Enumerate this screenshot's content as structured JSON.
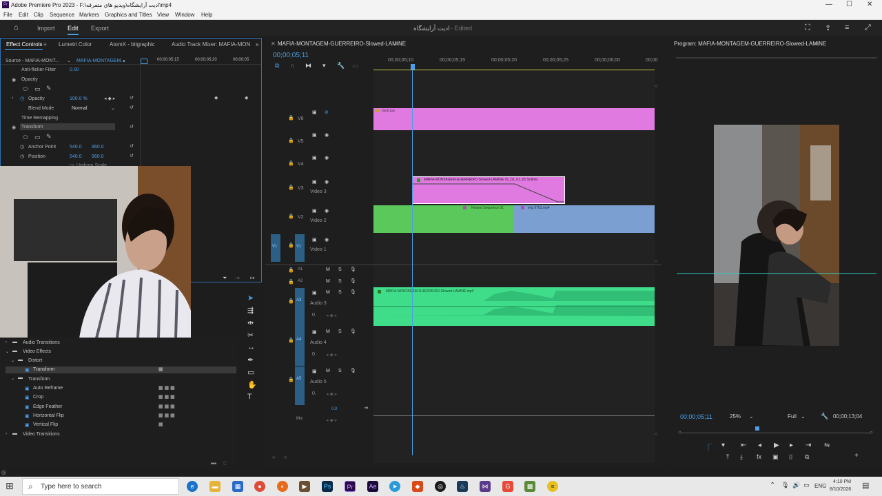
{
  "window": {
    "title": "Adobe Premiere Pro 2023 - F:\\ادیت آرایشگاه\\ویدیو های متفرقه\\mp4",
    "menu": [
      "File",
      "Edit",
      "Clip",
      "Sequence",
      "Markers",
      "Graphics and Titles",
      "View",
      "Window",
      "Help"
    ]
  },
  "header": {
    "nav": [
      "Import",
      "Edit",
      "Export"
    ],
    "active": "Edit",
    "project_title": "ادیت آرایشگاه",
    "edited": "- Edited"
  },
  "effect_controls": {
    "tabs": [
      "Effect Controls",
      "Lumetri Color",
      "AtomX - bitgraphic",
      "Audio Track Mixer: MAFIA-MON"
    ],
    "source": "Source - MAFIA-MONT...",
    "seq": "MAFIA-MONTAGEM...",
    "ruler": [
      "00;00;05;15",
      "00;00;05;20",
      "00;00;05"
    ],
    "rows": {
      "antiflicker": "Anti-flicker Filter",
      "antiflicker_val": "0.00",
      "opacity": "Opacity",
      "opacity_prop": "Opacity",
      "opacity_val": "100.0 %",
      "blend": "Blend Mode",
      "blend_val": "Normal",
      "time_remap": "Time Remapping",
      "transform": "Transform",
      "anchor": "Anchor Point",
      "anchor_x": "540.0",
      "anchor_y": "960.0",
      "position": "Position",
      "pos_x": "540.0",
      "pos_y": "960.0",
      "uniform": "Uniform Scale"
    }
  },
  "effects": {
    "audio_transitions": "Audio Transitions",
    "video_effects": "Video Effects",
    "distort": "Distort",
    "distort_transform": "Transform",
    "transform_folder": "Transform",
    "items": [
      "Auto Reframe",
      "Crop",
      "Edge Feather",
      "Horizontal Flip",
      "Vertical Flip"
    ],
    "video_transitions": "Video Transitions"
  },
  "timeline": {
    "tab": "MAFIA-MONTAGEM-GUERREIRO-Slowed-LAMINE",
    "timecode": "00;00;05;11",
    "ruler": [
      "00;00;05;10",
      "00;00;05;15",
      "00;00;05;20",
      "00;00;05;25",
      "00;00;06;00",
      "00;00"
    ],
    "video_tracks": [
      {
        "id": "V6",
        "name": ""
      },
      {
        "id": "V5",
        "name": ""
      },
      {
        "id": "V4",
        "name": ""
      },
      {
        "id": "V3",
        "name": "Video 3"
      },
      {
        "id": "V2",
        "name": "Video 2"
      },
      {
        "id": "V1",
        "name": "Video 1"
      }
    ],
    "audio_tracks": [
      {
        "id": "A1",
        "name": ""
      },
      {
        "id": "A2",
        "name": ""
      },
      {
        "id": "A3",
        "name": "Audio 3"
      },
      {
        "id": "A4",
        "name": "Audio 4"
      },
      {
        "id": "A5",
        "name": "Audio 5"
      }
    ],
    "source_v1": "V1",
    "mix": "Mix",
    "mix_val": "0.0",
    "clips": {
      "back": "back.jpg",
      "nested_top": "MAFIA-MONTAGEM-GUERREIRO-Slowed-LAMINE 01_01_01_01 Sollofa",
      "nested": "Nested Sequence 01",
      "img": "img 0703.mp4",
      "audio": "MAFIA-MONTAGEM-GUERREIRO-Slowed-LAMINE.mp3"
    },
    "db": "0."
  },
  "program": {
    "title": "Program: MAFIA-MONTAGEM-GUERREIRO-Slowed-LAMINE",
    "timecode": "00;00;05;11",
    "zoom": "25%",
    "quality": "Full",
    "duration": "00;00;13;04"
  },
  "taskbar": {
    "search_placeholder": "Type here to search",
    "lang": "ENG",
    "time": "4:10 PM",
    "date": "8/10/2026"
  },
  "colors": {
    "clip_pink": "#e07ae0",
    "clip_green": "#5ac85a",
    "clip_blue": "#7a9fd0",
    "audio_green": "#3fdc8a",
    "accent_blue": "#4a9fe8"
  }
}
